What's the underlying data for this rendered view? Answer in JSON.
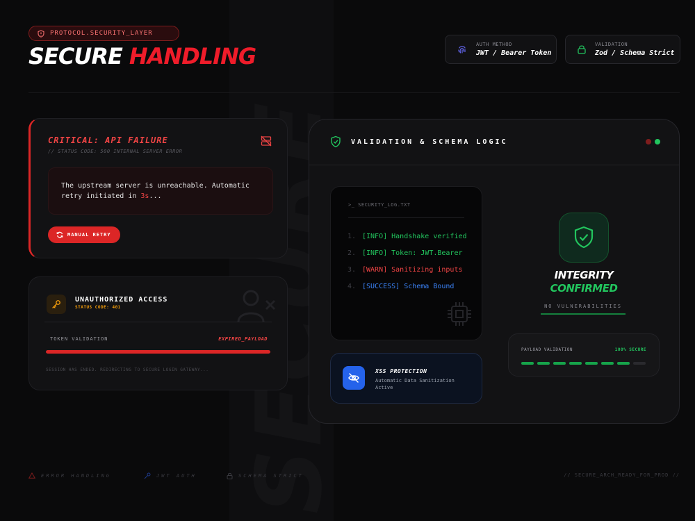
{
  "header": {
    "protocol_label": "PROTOCOL.SECURITY_LAYER",
    "title_white": "SECURE",
    "title_red": "HANDLING",
    "watermark": "SECURE",
    "auth_card": {
      "key": "AUTH METHOD",
      "value": "JWT / Bearer Token",
      "icon": "fingerprint-icon"
    },
    "validation_card": {
      "key": "VALIDATION",
      "value": "Zod / Schema Strict",
      "icon": "lock-icon"
    }
  },
  "critical": {
    "title": "CRITICAL: API FAILURE",
    "subtitle": "// STATUS CODE: 500 INTERNAL SERVER ERROR",
    "message": "The upstream server is unreachable. Automatic retry initiated in ",
    "countdown": "3s",
    "ellipsis": "...",
    "retry_label": "MANUAL RETRY",
    "accent": "#dc2626"
  },
  "unauthorized": {
    "title": "UNAUTHORIZED ACCESS",
    "status_code": "STATUS CODE: 401",
    "token_label": "TOKEN VALIDATION",
    "token_status": "EXPIRED_PAYLOAD",
    "token_progress": 1.0,
    "note": "SESSION HAS ENDED. REDIRECTING TO SECURE LOGIN GATEWAY..."
  },
  "validation_panel": {
    "title": "VALIDATION & SCHEMA LOGIC",
    "status_dots": [
      "#7f1d1d",
      "#22c55e"
    ],
    "log": {
      "filename": ">_ SECURITY_LOG.TXT",
      "lines": [
        {
          "num": "1.",
          "text": "[INFO] Handshake verified",
          "level": "info"
        },
        {
          "num": "2.",
          "text": "[INFO] Token: JWT.Bearer",
          "level": "info"
        },
        {
          "num": "3.",
          "text": "[WARN] Sanitizing inputs",
          "level": "warn"
        },
        {
          "num": "4.",
          "text": "[SUCCESS] Schema Bound",
          "level": "success"
        }
      ]
    },
    "xss": {
      "title": "XSS PROTECTION",
      "subtitle": "Automatic Data Sanitization Active",
      "icon": "eye-off-icon"
    },
    "integrity": {
      "line1": "INTEGRITY",
      "line2": "CONFIRMED",
      "tag": "NO VULNERABILITIES"
    },
    "payload": {
      "label": "PAYLOAD VALIDATION",
      "status": "100% SECURE",
      "segments_filled": 7,
      "segments_total": 8
    }
  },
  "footer": {
    "items": [
      "ERROR HANDLING",
      "JWT AUTH",
      "SCHEMA STRICT"
    ],
    "right": "// SECURE_ARCH_READY_FOR_PROD //"
  }
}
